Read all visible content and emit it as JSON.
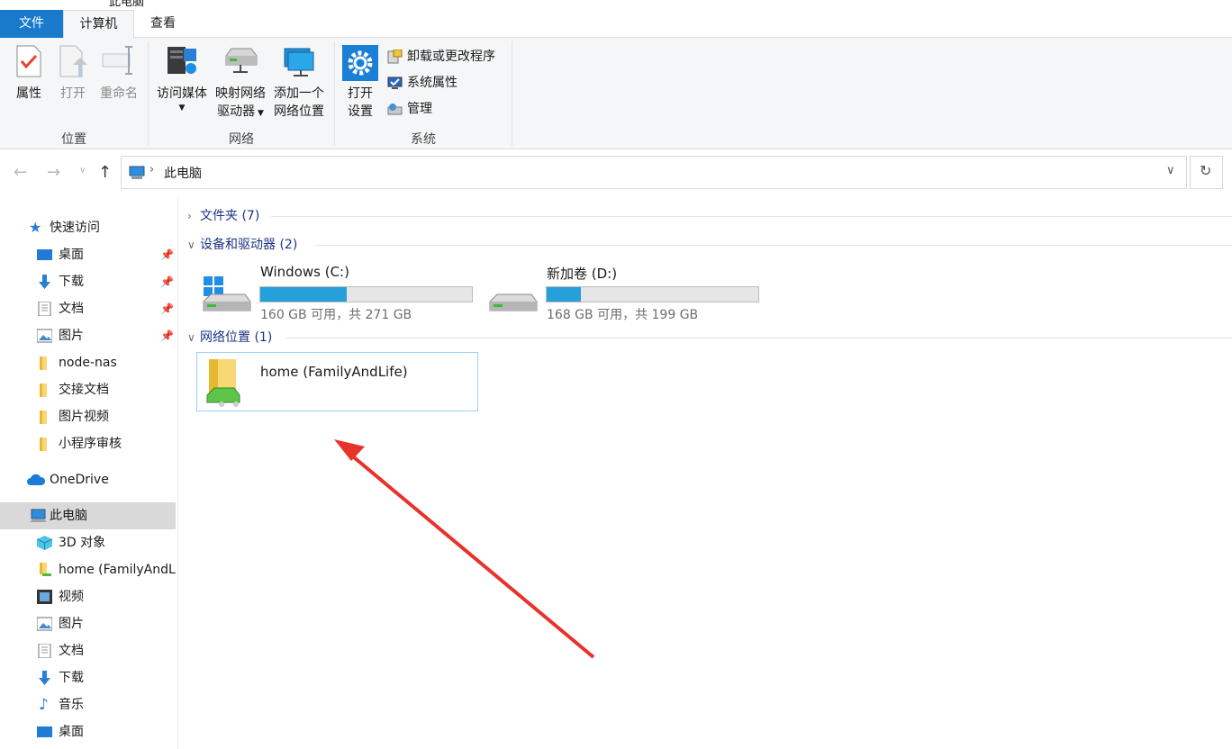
{
  "window": {
    "title": "此电脑"
  },
  "tabs": {
    "file": "文件",
    "computer": "计算机",
    "view": "查看"
  },
  "ribbon": {
    "location": {
      "label": "位置",
      "properties": "属性",
      "open": "打开",
      "rename": "重命名"
    },
    "network": {
      "label": "网络",
      "media_1": "访问媒体",
      "map_1": "映射网络",
      "map_2": "驱动器",
      "add_1": "添加一个",
      "add_2": "网络位置"
    },
    "system": {
      "label": "系统",
      "settings_1": "打开",
      "settings_2": "设置",
      "uninstall": "卸载或更改程序",
      "sysprops": "系统属性",
      "manage": "管理"
    }
  },
  "address": {
    "crumb": "此电脑"
  },
  "sidebar": {
    "quick_access": "快速访问",
    "quick_items": [
      "桌面",
      "下载",
      "文档",
      "图片",
      "node-nas",
      "交接文档",
      "图片视频",
      "小程序审核"
    ],
    "onedrive": "OneDrive",
    "this_pc": "此电脑",
    "pc_items": [
      "3D 对象",
      "home (FamilyAndLife)",
      "视频",
      "图片",
      "文档",
      "下载",
      "音乐",
      "桌面"
    ]
  },
  "content": {
    "folders_header": "文件夹 (7)",
    "devices_header": "设备和驱动器 (2)",
    "network_header": "网络位置 (1)",
    "drives": [
      {
        "name": "Windows (C:)",
        "size": "160 GB 可用，共 271 GB",
        "used_fraction": 0.41
      },
      {
        "name": "新加卷 (D:)",
        "size": "168 GB 可用，共 199 GB",
        "used_fraction": 0.16
      }
    ],
    "network_location": "home (FamilyAndLife)"
  },
  "colors": {
    "accent": "#1979ca",
    "drive_fill": "#26a0da",
    "arrow": "#e8332a"
  }
}
